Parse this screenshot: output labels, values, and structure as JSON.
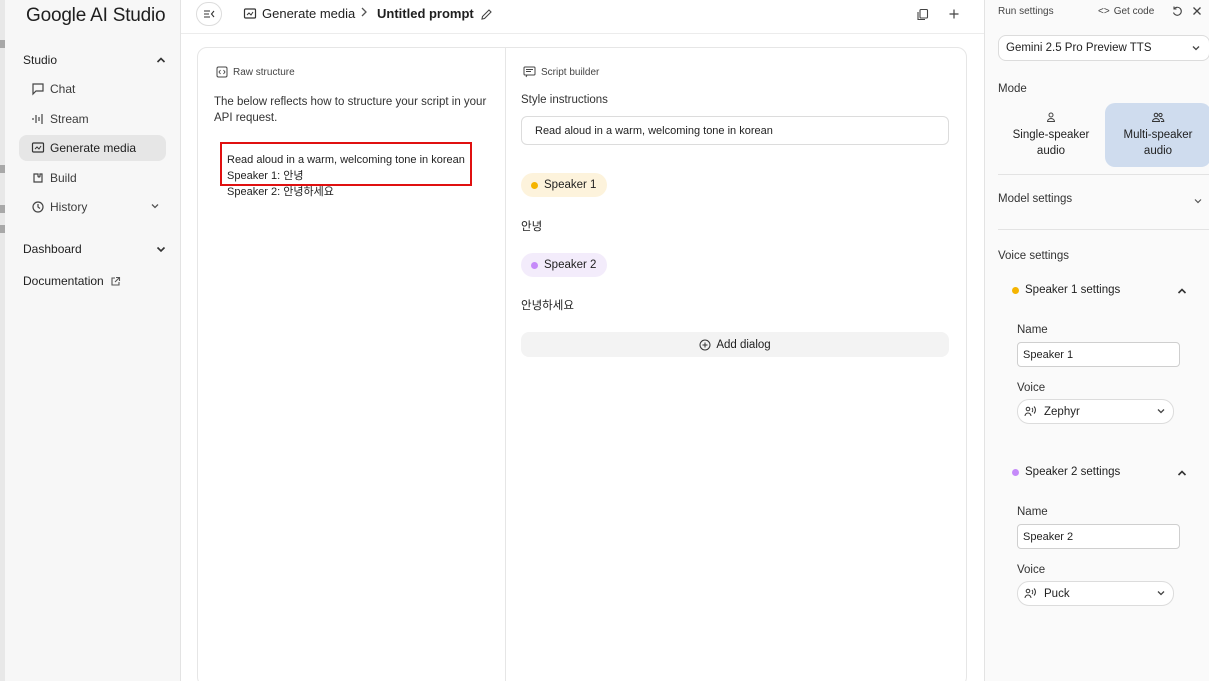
{
  "app": {
    "logo": "Google AI Studio"
  },
  "sidebar": {
    "studio_label": "Studio",
    "items": [
      {
        "label": "Chat",
        "icon": "chat-icon"
      },
      {
        "label": "Stream",
        "icon": "stream-icon"
      },
      {
        "label": "Generate media",
        "icon": "media-icon",
        "active": true
      },
      {
        "label": "Build",
        "icon": "build-icon"
      },
      {
        "label": "History",
        "icon": "history-icon"
      }
    ],
    "dashboard_label": "Dashboard",
    "documentation_label": "Documentation"
  },
  "topbar": {
    "breadcrumb": "Generate media",
    "title": "Untitled prompt"
  },
  "raw": {
    "header": "Raw structure",
    "description": "The below reflects how to structure your script in your API request.",
    "line1": "Read aloud in a warm, welcoming tone in korean",
    "line2": "Speaker 1: 안녕",
    "line3": "Speaker 2: 안녕하세요"
  },
  "script": {
    "header": "Script builder",
    "style_label": "Style instructions",
    "style_value": "Read aloud in a warm, welcoming tone in korean",
    "speaker1": {
      "label": "Speaker 1",
      "text": "안녕",
      "color": "#f5b400"
    },
    "speaker2": {
      "label": "Speaker 2",
      "text": "안녕하세요",
      "color": "#c58af9"
    },
    "add_dialog": "Add dialog"
  },
  "run": {
    "title": "Run settings",
    "get_code": "Get code",
    "model": "Gemini 2.5 Pro Preview TTS",
    "mode_label": "Mode",
    "mode_single_1": "Single-speaker",
    "mode_single_2": "audio",
    "mode_multi_1": "Multi-speaker",
    "mode_multi_2": "audio",
    "model_settings": "Model settings",
    "voice_settings": "Voice settings",
    "s1": {
      "title": "Speaker 1 settings",
      "name_label": "Name",
      "name_value": "Speaker 1",
      "voice_label": "Voice",
      "voice_value": "Zephyr"
    },
    "s2": {
      "title": "Speaker 2 settings",
      "name_label": "Name",
      "name_value": "Speaker 2",
      "voice_label": "Voice",
      "voice_value": "Puck"
    }
  }
}
